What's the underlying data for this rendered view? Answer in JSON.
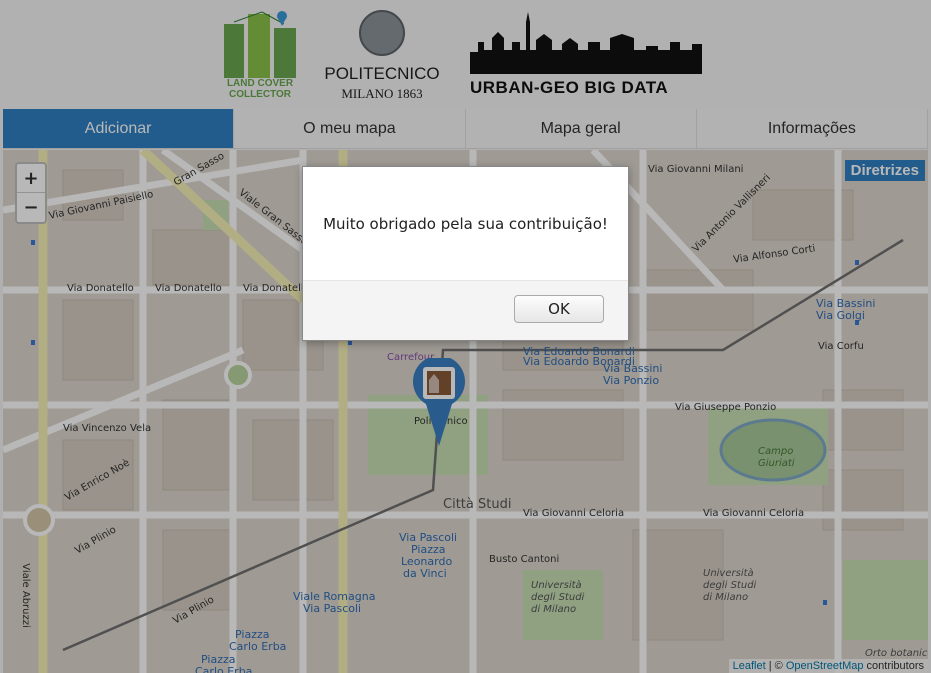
{
  "header": {
    "logo_lcc": "LAND COVER COLLECTOR",
    "logo_polimi_name": "POLITECNICO",
    "logo_polimi_sub": "MILANO 1863",
    "logo_urban": "URBAN-GEO BIG DATA"
  },
  "nav": {
    "tabs": [
      {
        "label": "Adicionar"
      },
      {
        "label": "O meu mapa"
      },
      {
        "label": "Mapa geral"
      },
      {
        "label": "Informações"
      }
    ]
  },
  "map": {
    "zoom_in": "+",
    "zoom_out": "−",
    "diretrizes": "Diretrizes",
    "attribution_leaflet": "Leaflet",
    "attribution_sep": " | © ",
    "attribution_osm": "OpenStreetMap",
    "attribution_contrib": " contributors",
    "labels": {
      "gran_sasso": "Gran Sasso",
      "via_giovanni_paisiello": "Via Giovanni Paisiello",
      "viale_gran_sasso": "Viale Gran Sasso",
      "via_donatello_1": "Via Donatello",
      "via_donatello_2": "Via Donatello",
      "via_donatello_3": "Via Donatello",
      "via_giovanni_milani": "Via Giovanni Milani",
      "via_antonio_vallisneri": "Via Antonio Vallisneri",
      "via_alfonso_corti": "Via Alfonso Corti",
      "via_edoardo_bonardi_1": "Via Edoardo Bonardi",
      "via_edoardo_bonardi_2": "Via Edoardo Bonardi",
      "via_bassini_golgi_1": "Via Bassini",
      "via_bassini_golgi_2": "Via Golgi",
      "via_corfu": "Via Corfu",
      "via_bassini_ponzio_1": "Via Bassini",
      "via_bassini_ponzio_2": "Via Ponzio",
      "via_giuseppe_ponzio": "Via Giuseppe Ponzio",
      "campo_giuriati_1": "Campo",
      "campo_giuriati_2": "Giuriati",
      "carrefour": "Carrefour",
      "politecnico": "Politecnico",
      "citta_studi": "Città Studi",
      "via_giovanni_celoria_1": "Via Giovanni Celoria",
      "via_giovanni_celoria_2": "Via Giovanni Celoria",
      "via_vincenzo_vela": "Via Vincenzo Vela",
      "via_enrico_noe": "Via Enrico Noè",
      "viale_abruzzi": "Viale Abruzzi",
      "via_pascoli_1": "Via Pascoli",
      "via_pascoli_2": "Piazza",
      "via_pascoli_3": "Leonardo",
      "via_pascoli_4": "da Vinci",
      "busto_cantoni": "Busto Cantoni",
      "uni_1": "Università",
      "uni_2": "degli Studi",
      "uni_3": "di Milano",
      "uni_b1": "Università",
      "uni_b2": "degli Studi",
      "uni_b3": "di Milano",
      "viale_romagna": "Viale Romagna",
      "via_pascoli_b": "Via Pascoli",
      "piazza_carlo_erba_1": "Piazza",
      "piazza_carlo_erba_2": "Carlo Erba",
      "piazza_carlo_erba_3": "Piazza",
      "piazza_carlo_erba_4": "Carlo Erba",
      "via_plinio_1": "Via Plinio",
      "via_plinio_2": "Via Plinio",
      "orto_botanico": "Orto botanico"
    }
  },
  "dialog": {
    "message": "Muito obrigado pela sua contribuição!",
    "ok_label": "OK"
  },
  "colors": {
    "accent": "#2f80c2",
    "marker": "#3b7fc4",
    "map_bg": "#ddd6cd",
    "park": "#c8dfb5"
  }
}
